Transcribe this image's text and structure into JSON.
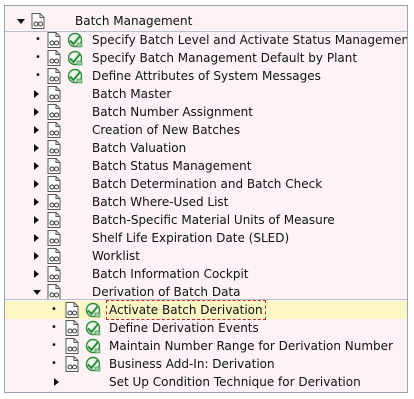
{
  "tree": {
    "root": {
      "label": "Batch Management"
    },
    "items": [
      {
        "label": "Specify Batch Level and Activate Status Management",
        "level": 1,
        "kind": "activity"
      },
      {
        "label": "Specify Batch Management Default by Plant",
        "level": 1,
        "kind": "activity"
      },
      {
        "label": "Define Attributes of System Messages",
        "level": 1,
        "kind": "activity"
      },
      {
        "label": "Batch Master",
        "level": 1,
        "kind": "folder"
      },
      {
        "label": "Batch Number Assignment",
        "level": 1,
        "kind": "folder"
      },
      {
        "label": "Creation of New Batches",
        "level": 1,
        "kind": "folder"
      },
      {
        "label": "Batch Valuation",
        "level": 1,
        "kind": "folder"
      },
      {
        "label": "Batch Status Management",
        "level": 1,
        "kind": "folder"
      },
      {
        "label": "Batch Determination and Batch Check",
        "level": 1,
        "kind": "folder"
      },
      {
        "label": "Batch Where-Used List",
        "level": 1,
        "kind": "folder"
      },
      {
        "label": "Batch-Specific Material Units of Measure",
        "level": 1,
        "kind": "folder"
      },
      {
        "label": "Shelf Life Expiration Date (SLED)",
        "level": 1,
        "kind": "folder"
      },
      {
        "label": "Worklist",
        "level": 1,
        "kind": "folder"
      },
      {
        "label": "Batch Information Cockpit",
        "level": 1,
        "kind": "folder"
      },
      {
        "label": "Derivation of Batch Data",
        "level": 1,
        "kind": "open-folder"
      },
      {
        "label": "Activate Batch Derivation",
        "level": 2,
        "kind": "activity",
        "selected": true
      },
      {
        "label": "Define Derivation Events",
        "level": 2,
        "kind": "activity"
      },
      {
        "label": "Maintain Number Range for Derivation Number",
        "level": 2,
        "kind": "activity"
      },
      {
        "label": "Business Add-In:  Derivation",
        "level": 2,
        "kind": "activity"
      },
      {
        "label": "Set Up Condition Technique for Derivation",
        "level": 2,
        "kind": "node"
      }
    ]
  },
  "icons": {
    "doc": "documentation-icon",
    "exec": "execute-activity-icon"
  },
  "colors": {
    "background": "#fdf3f4",
    "selection": "#fbf6c3",
    "focus_outline": "#c62828",
    "exec_green": "#2e8b3d"
  }
}
